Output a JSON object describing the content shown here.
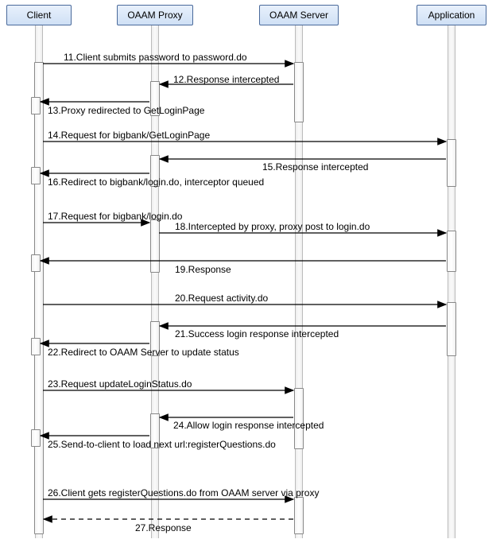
{
  "actors": {
    "client": "Client",
    "proxy": "OAAM Proxy",
    "server": "OAAM Server",
    "app": "Application"
  },
  "messages": {
    "m11": "11.Client submits password to password.do",
    "m12": "12.Response intercepted",
    "m13": "13.Proxy redirected to GetLoginPage",
    "m14": "14.Request for bigbank/GetLoginPage",
    "m15": "15.Response intercepted",
    "m16": "16.Redirect to bigbank/login.do, interceptor queued",
    "m17": "17.Request for bigbank/login.do",
    "m18": "18.Intercepted by proxy, proxy post to login.do",
    "m19": "19.Response",
    "m20": "20.Request activity.do",
    "m21": "21.Success login response intercepted",
    "m22": "22.Redirect to OAAM Server to update status",
    "m23": "23.Request updateLoginStatus.do",
    "m24": "24.Allow login response intercepted",
    "m25": "25.Send-to-client to load next url:registerQuestions.do",
    "m26": "26.Client gets registerQuestions.do from OAAM server via proxy",
    "m27": "27.Response"
  }
}
